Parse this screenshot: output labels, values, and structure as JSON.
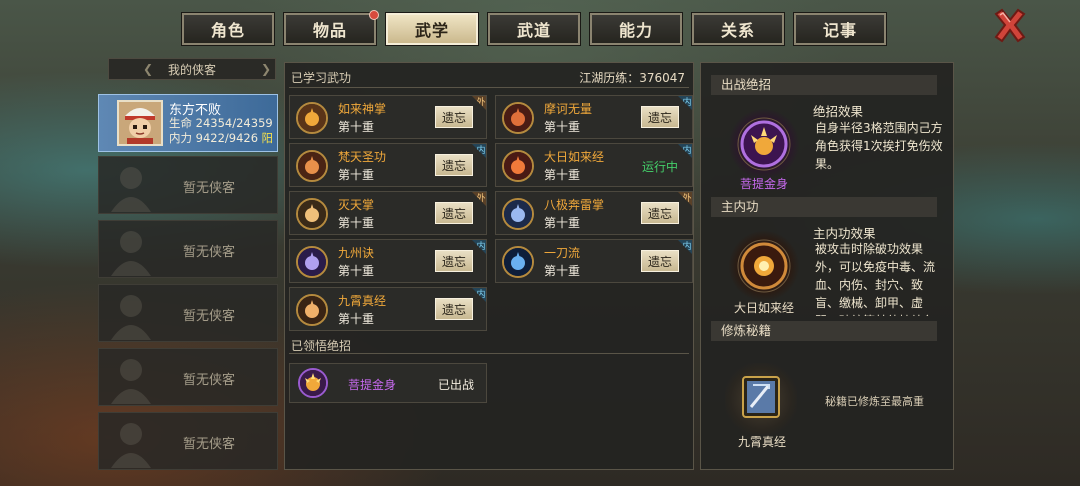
{
  "tabs": [
    {
      "label": "角色"
    },
    {
      "label": "物品"
    },
    {
      "label": "武学"
    },
    {
      "label": "武道"
    },
    {
      "label": "能力"
    },
    {
      "label": "关系"
    },
    {
      "label": "记事"
    }
  ],
  "roster": {
    "header": "我的侠客",
    "active": {
      "name": "东方不败",
      "hp_label": "生命",
      "hp_value": "24354/24359",
      "mp_label": "内力",
      "mp_value": "9422/9426",
      "element": "阳"
    },
    "empty_label": "暂无侠客"
  },
  "learned": {
    "title": "已学习武功",
    "experience": "江湖历练：376047",
    "forget_label": "遗忘",
    "running_label": "运行中",
    "skills": [
      {
        "name": "如来神掌",
        "level": "第十重",
        "tag": "外",
        "tag_type": "wai",
        "state": "forget"
      },
      {
        "name": "摩诃无量",
        "level": "第十重",
        "tag": "内",
        "tag_type": "nei",
        "state": "forget"
      },
      {
        "name": "梵天圣功",
        "level": "第十重",
        "tag": "内",
        "tag_type": "nei",
        "state": "forget"
      },
      {
        "name": "大日如来经",
        "level": "第十重",
        "tag": "内",
        "tag_type": "nei",
        "state": "running"
      },
      {
        "name": "灭天掌",
        "level": "第十重",
        "tag": "外",
        "tag_type": "wai",
        "state": "forget"
      },
      {
        "name": "八极奔雷掌",
        "level": "第十重",
        "tag": "外",
        "tag_type": "wai",
        "state": "forget"
      },
      {
        "name": "九州诀",
        "level": "第十重",
        "tag": "内",
        "tag_type": "nei",
        "state": "forget"
      },
      {
        "name": "一刀流",
        "level": "第十重",
        "tag": "内",
        "tag_type": "nei",
        "state": "forget"
      },
      {
        "name": "九霄真经",
        "level": "第十重",
        "tag": "内",
        "tag_type": "nei",
        "state": "forget"
      }
    ]
  },
  "ultimates": {
    "title": "已领悟绝招",
    "items": [
      {
        "name": "菩提金身",
        "status": "已出战"
      }
    ]
  },
  "right": {
    "battle": {
      "header": "出战绝招",
      "medal_label": "菩提金身",
      "title": "绝招效果",
      "desc": "自身半径3格范围内己方角色获得1次挨打免伤效果。"
    },
    "inner": {
      "header": "主内功",
      "medal_label": "大日如来经",
      "title": "主内功效果",
      "desc": "被攻击时除破功效果外，可以免疫中毒、流血、内伤、封穴、致盲、缴械、卸甲、虚弱、破绽等其他持续负面效果。"
    },
    "manual": {
      "header": "修炼秘籍",
      "medal_label": "九霄真经",
      "note": "秘籍已修炼至最高重"
    }
  },
  "colors": {
    "accent_gold": "#f0a83a",
    "running_green": "#44d06a",
    "ultimate_purple": "#c86af0",
    "active_slot_blue": "#5f88b4",
    "close_red": "#d0443a"
  }
}
